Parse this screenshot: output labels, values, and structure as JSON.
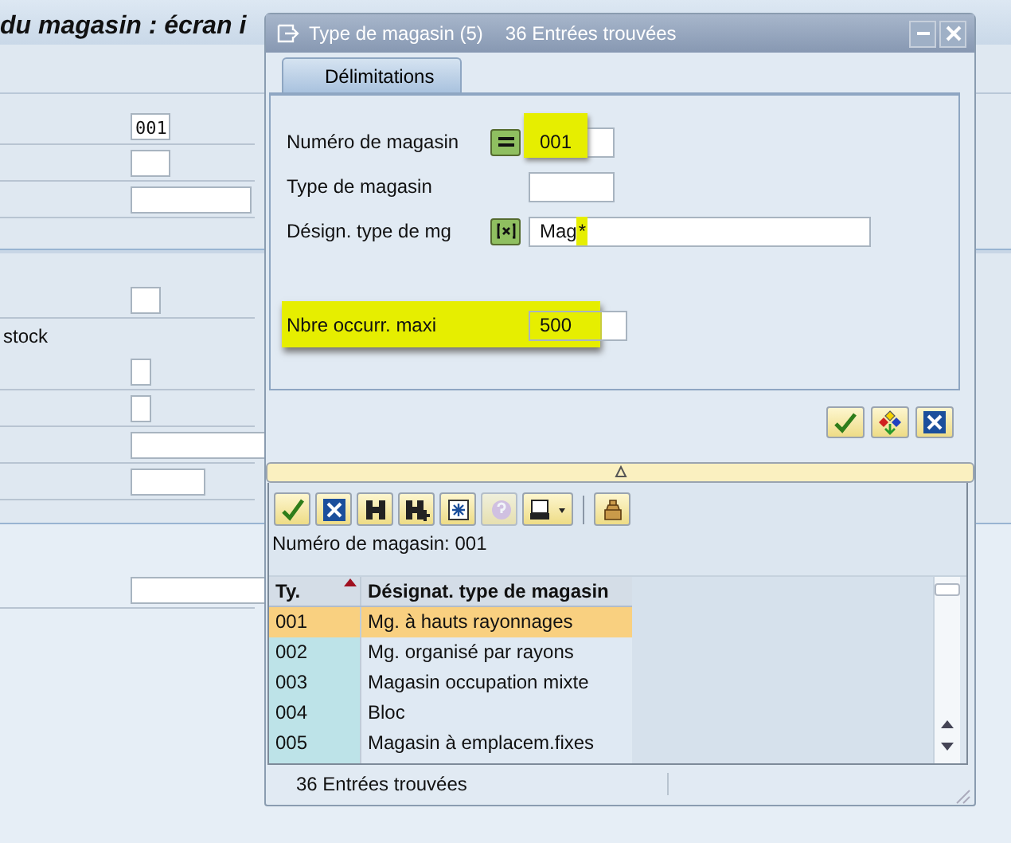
{
  "background": {
    "title": "du magasin : écran i",
    "warehouse_field": "001",
    "stock_label": "stock"
  },
  "dialog": {
    "title": "Type de magasin (5)",
    "subtitle": "36 Entrées trouvées",
    "tabs": [
      {
        "label": "Délimitations",
        "selected": true
      }
    ],
    "criteria": [
      {
        "label": "Numéro de magasin",
        "kind": "equals",
        "value": "001",
        "highlighted": true
      },
      {
        "label": "Type de magasin",
        "kind": "plain"
      },
      {
        "label": "Désign. type de mg",
        "kind": "pattern",
        "value": "Mag*",
        "last_char_highlighted": true
      }
    ],
    "max_hits": {
      "label": "Nbre occurr. maxi",
      "value": "500",
      "highlighted": true
    },
    "actions": [
      {
        "kind": "confirm"
      },
      {
        "kind": "multi"
      },
      {
        "kind": "cancel"
      }
    ],
    "toolbar": [
      {
        "kind": "confirm",
        "disabled": false
      },
      {
        "kind": "cancel",
        "disabled": false
      },
      {
        "kind": "find",
        "disabled": false
      },
      {
        "kind": "find-next",
        "disabled": false
      },
      {
        "kind": "new",
        "disabled": false
      },
      {
        "kind": "help",
        "disabled": true
      },
      {
        "kind": "print",
        "disabled": false
      },
      {
        "kind": "separator"
      },
      {
        "kind": "clear",
        "disabled": false
      }
    ],
    "info": "Numéro de magasin: 001",
    "columns": [
      {
        "label": "Ty.",
        "sorted": true
      },
      {
        "label": "Désignat. type de magasin",
        "sorted": false
      }
    ],
    "rows": [
      {
        "cells": [
          "001",
          "Mg. à hauts rayonnages"
        ],
        "selected": true
      },
      {
        "cells": [
          "002",
          "Mg. organisé par rayons"
        ],
        "selected": false
      },
      {
        "cells": [
          "003",
          "Magasin occupation mixte"
        ],
        "selected": false
      },
      {
        "cells": [
          "004",
          "Bloc"
        ],
        "selected": false
      },
      {
        "cells": [
          "005",
          "Magasin à emplacem.fixes"
        ],
        "selected": false
      }
    ],
    "status": "36 Entrées trouvées"
  }
}
